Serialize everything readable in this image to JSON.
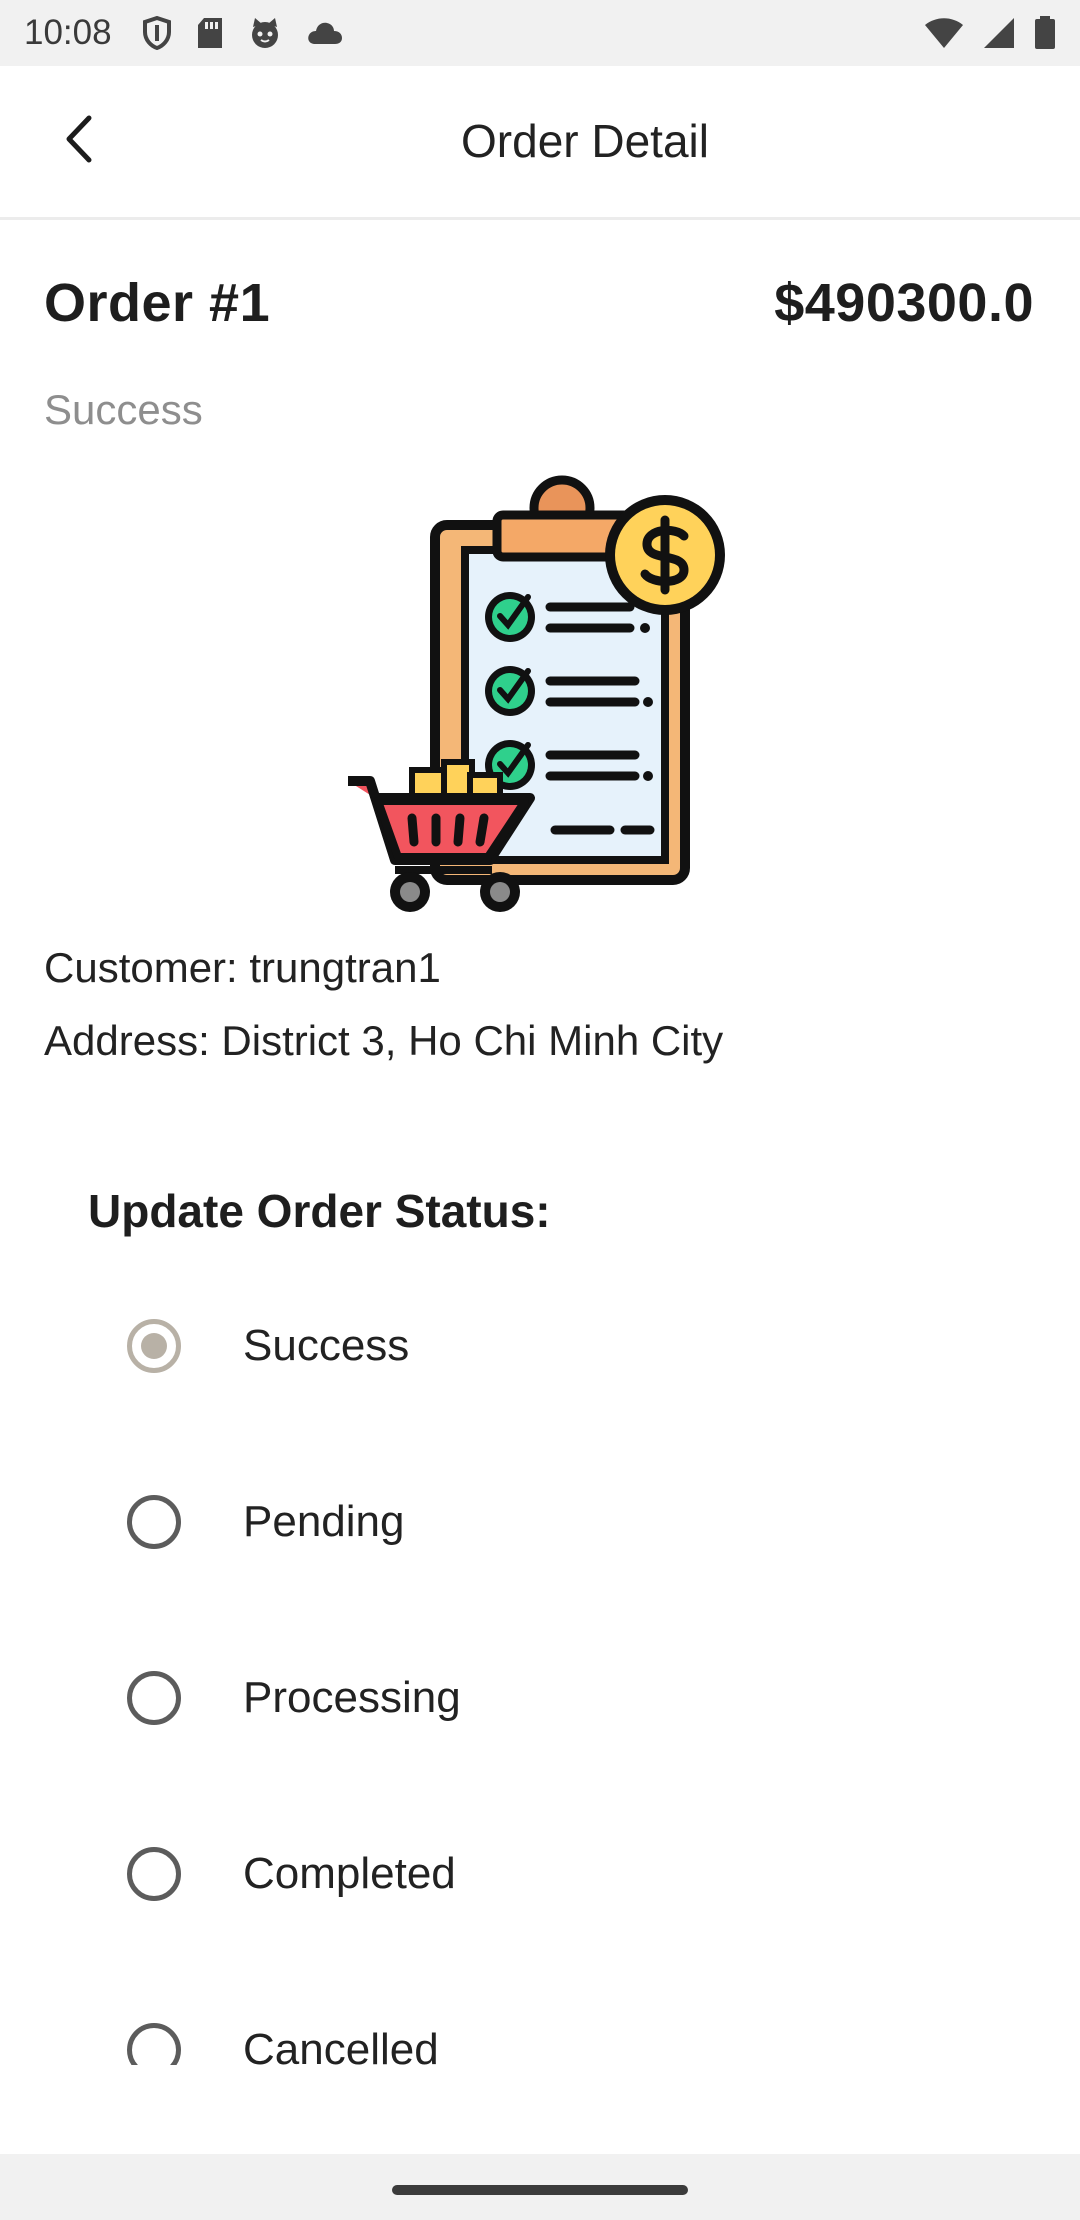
{
  "status_bar": {
    "time": "10:08",
    "left_icons": [
      "shield-icon",
      "sd-card-icon",
      "cat-face-icon",
      "cloud-icon"
    ],
    "right_icons": [
      "wifi-icon",
      "signal-icon",
      "battery-icon"
    ]
  },
  "app_bar": {
    "title": "Order Detail",
    "back_icon": "chevron-left-icon"
  },
  "order": {
    "title": "Order #1",
    "total": "$490300.0",
    "status": "Success",
    "customer": "Customer: trungtran1",
    "address": "Address: District 3, Ho Chi Minh City"
  },
  "update_status": {
    "heading": "Update Order Status:",
    "options": [
      {
        "label": "Success",
        "selected": true
      },
      {
        "label": "Pending",
        "selected": false
      },
      {
        "label": "Processing",
        "selected": false
      },
      {
        "label": "Completed",
        "selected": false
      },
      {
        "label": "Cancelled",
        "selected": false
      }
    ]
  },
  "colors": {
    "radio_selected": "#b8b1a6",
    "radio_unselected": "#5c5c5c",
    "status_text": "#8e8e8e"
  }
}
